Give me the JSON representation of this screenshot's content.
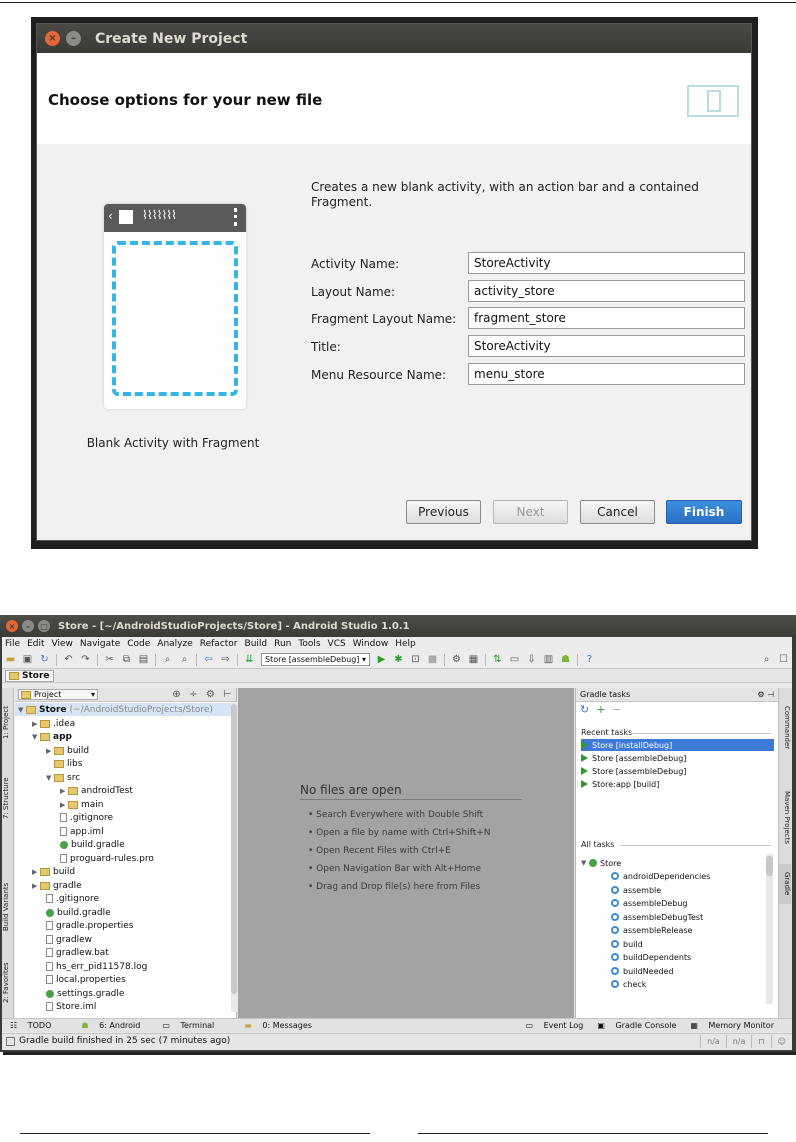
{
  "dialog": {
    "window_title": "Create New Project",
    "header": "Choose options for your new file",
    "template_caption": "Blank Activity with Fragment",
    "description": "Creates a new blank activity, with an action bar and a contained Fragment.",
    "fields": [
      {
        "label": "Activity Name:",
        "value": "StoreActivity"
      },
      {
        "label": "Layout Name:",
        "value": "activity_store"
      },
      {
        "label": "Fragment Layout Name:",
        "value": "fragment_store"
      },
      {
        "label": "Title:",
        "value": "StoreActivity"
      },
      {
        "label": "Menu Resource Name:",
        "value": "menu_store"
      }
    ],
    "buttons": {
      "previous": "Previous",
      "next": "Next",
      "cancel": "Cancel",
      "finish": "Finish"
    }
  },
  "studio": {
    "window_title": "Store - [~/AndroidStudioProjects/Store] - Android Studio 1.0.1",
    "menu": [
      "File",
      "Edit",
      "View",
      "Navigate",
      "Code",
      "Analyze",
      "Refactor",
      "Build",
      "Run",
      "Tools",
      "VCS",
      "Window",
      "Help"
    ],
    "run_config": "Store [assembleDebug]",
    "breadcrumb": "Store",
    "left_tabs": {
      "project": "1: Project",
      "structure": "7: Structure",
      "build_variants": "Build Variants",
      "favorites": "2: Favorites"
    },
    "right_tabs": {
      "commander": "Commander",
      "maven": "Maven Projects",
      "gradle": "Gradle"
    },
    "project_panel": {
      "selector": "Project",
      "root": "Store",
      "root_path": "(~/AndroidStudioProjects/Store)",
      "items": [
        ".idea",
        "app",
        "build",
        "libs",
        "src",
        "androidTest",
        "main",
        ".gitignore",
        "app.iml",
        "build.gradle",
        "proguard-rules.pro",
        "build",
        "gradle",
        ".gitignore",
        "build.gradle",
        "gradle.properties",
        "gradlew",
        "gradlew.bat",
        "hs_err_pid11578.log",
        "local.properties",
        "settings.gradle",
        "Store.iml"
      ]
    },
    "editor": {
      "title": "No files are open",
      "tips": [
        "• Search Everywhere with Double Shift",
        "• Open a file by name with Ctrl+Shift+N",
        "• Open Recent Files with Ctrl+E",
        "• Open Navigation Bar with Alt+Home",
        "• Drag and Drop file(s) here from Files"
      ]
    },
    "gradle_panel": {
      "title": "Gradle tasks",
      "recent_label": "Recent tasks",
      "recent": [
        "Store [installDebug]",
        "Store [assembleDebug]",
        "Store [assembleDebug]",
        "Store:app [build]"
      ],
      "all_label": "All tasks",
      "all_root": "Store",
      "all": [
        "androidDependencies",
        "assemble",
        "assembleDebug",
        "assembleDebugTest",
        "assembleRelease",
        "build",
        "buildDependents",
        "buildNeeded",
        "check"
      ]
    },
    "bottom_tabs": {
      "todo": "TODO",
      "android": "6: Android",
      "terminal": "Terminal",
      "messages": "0: Messages",
      "event_log": "Event Log",
      "gradle_console": "Gradle Console",
      "memory": "Memory Monitor"
    },
    "status": {
      "message": "Gradle build finished in 25 sec (7 minutes ago)",
      "cell1": "n/a",
      "cell2": "n/a"
    }
  }
}
